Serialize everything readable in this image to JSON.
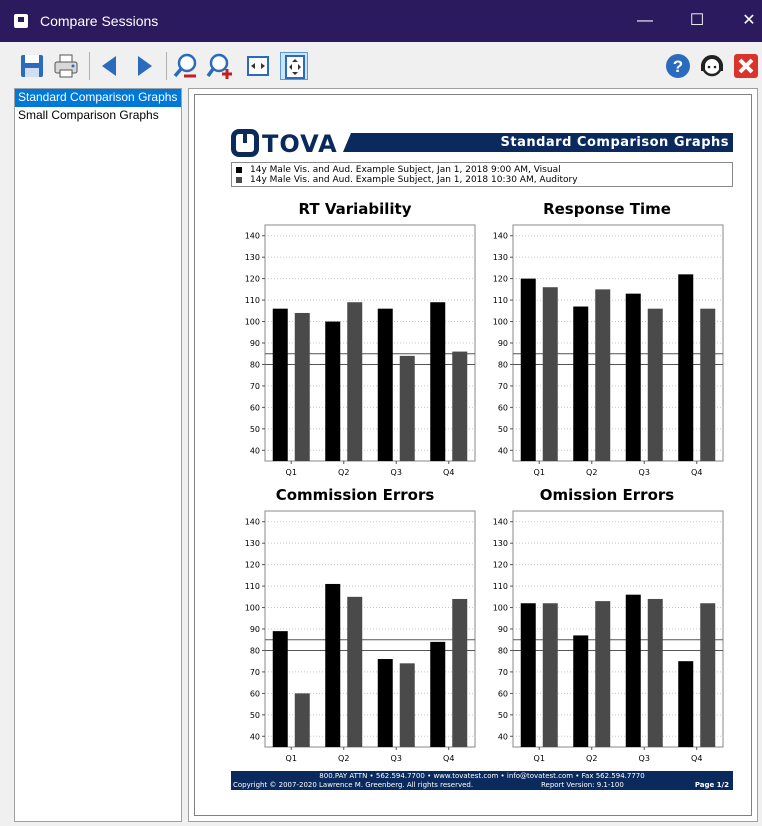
{
  "window": {
    "title": "Compare Sessions",
    "minimize": "—",
    "maximize": "☐",
    "close": "✕"
  },
  "toolbar": {
    "icons": [
      "save-icon",
      "print-icon",
      "previous-icon",
      "next-icon",
      "zoom-out-icon",
      "zoom-in-icon",
      "fit-width-icon",
      "fit-page-icon",
      "help-icon",
      "support-icon",
      "exit-icon"
    ]
  },
  "sidebar": {
    "items": [
      {
        "label": "Standard Comparison Graphs",
        "selected": true
      },
      {
        "label": "Small Comparison Graphs",
        "selected": false
      }
    ]
  },
  "report": {
    "logo": "TOVA",
    "banner": "Standard Comparison Graphs",
    "sessions": [
      {
        "text": "14y Male Vis. and Aud. Example Subject, Jan 1, 2018 9:00 AM, Visual",
        "color": "#000000"
      },
      {
        "text": "14y Male Vis. and Aud. Example Subject, Jan 1, 2018 10:30 AM, Auditory",
        "color": "#4a4a4a"
      }
    ],
    "footer": {
      "line1": "800.PAY ATTN • 562.594.7700 • www.tovatest.com • info@tovatest.com • Fax 562.594.7770",
      "copyright": "Copyright © 2007-2020 Lawrence M. Greenberg. All rights reserved.",
      "version": "Report Version: 9.1-100",
      "page": "Page 1/2"
    }
  },
  "colors": {
    "series1": "#000000",
    "series2": "#4a4a4a",
    "navy": "#0a2a5e"
  },
  "chart_data": [
    {
      "type": "bar",
      "title": "RT Variability",
      "categories": [
        "Q1",
        "Q2",
        "Q3",
        "Q4"
      ],
      "series": [
        {
          "values": [
            106,
            100,
            106,
            109
          ]
        },
        {
          "values": [
            104,
            109,
            84,
            86
          ]
        }
      ],
      "ylim": [
        35,
        145
      ],
      "yticks": [
        40,
        50,
        60,
        70,
        80,
        90,
        100,
        110,
        120,
        130,
        140
      ],
      "reference_lines": [
        80,
        85
      ],
      "grid": true
    },
    {
      "type": "bar",
      "title": "Response Time",
      "categories": [
        "Q1",
        "Q2",
        "Q3",
        "Q4"
      ],
      "series": [
        {
          "values": [
            120,
            107,
            113,
            122
          ]
        },
        {
          "values": [
            116,
            115,
            106,
            106
          ]
        }
      ],
      "ylim": [
        35,
        145
      ],
      "yticks": [
        40,
        50,
        60,
        70,
        80,
        90,
        100,
        110,
        120,
        130,
        140
      ],
      "reference_lines": [
        80,
        85
      ],
      "grid": true
    },
    {
      "type": "bar",
      "title": "Commission Errors",
      "categories": [
        "Q1",
        "Q2",
        "Q3",
        "Q4"
      ],
      "series": [
        {
          "values": [
            89,
            111,
            76,
            84
          ]
        },
        {
          "values": [
            60,
            105,
            74,
            104
          ]
        }
      ],
      "ylim": [
        35,
        145
      ],
      "yticks": [
        40,
        50,
        60,
        70,
        80,
        90,
        100,
        110,
        120,
        130,
        140
      ],
      "reference_lines": [
        80,
        85
      ],
      "grid": true
    },
    {
      "type": "bar",
      "title": "Omission Errors",
      "categories": [
        "Q1",
        "Q2",
        "Q3",
        "Q4"
      ],
      "series": [
        {
          "values": [
            102,
            87,
            106,
            75
          ]
        },
        {
          "values": [
            102,
            103,
            104,
            102
          ]
        }
      ],
      "ylim": [
        35,
        145
      ],
      "yticks": [
        40,
        50,
        60,
        70,
        80,
        90,
        100,
        110,
        120,
        130,
        140
      ],
      "reference_lines": [
        80,
        85
      ],
      "grid": true
    }
  ]
}
